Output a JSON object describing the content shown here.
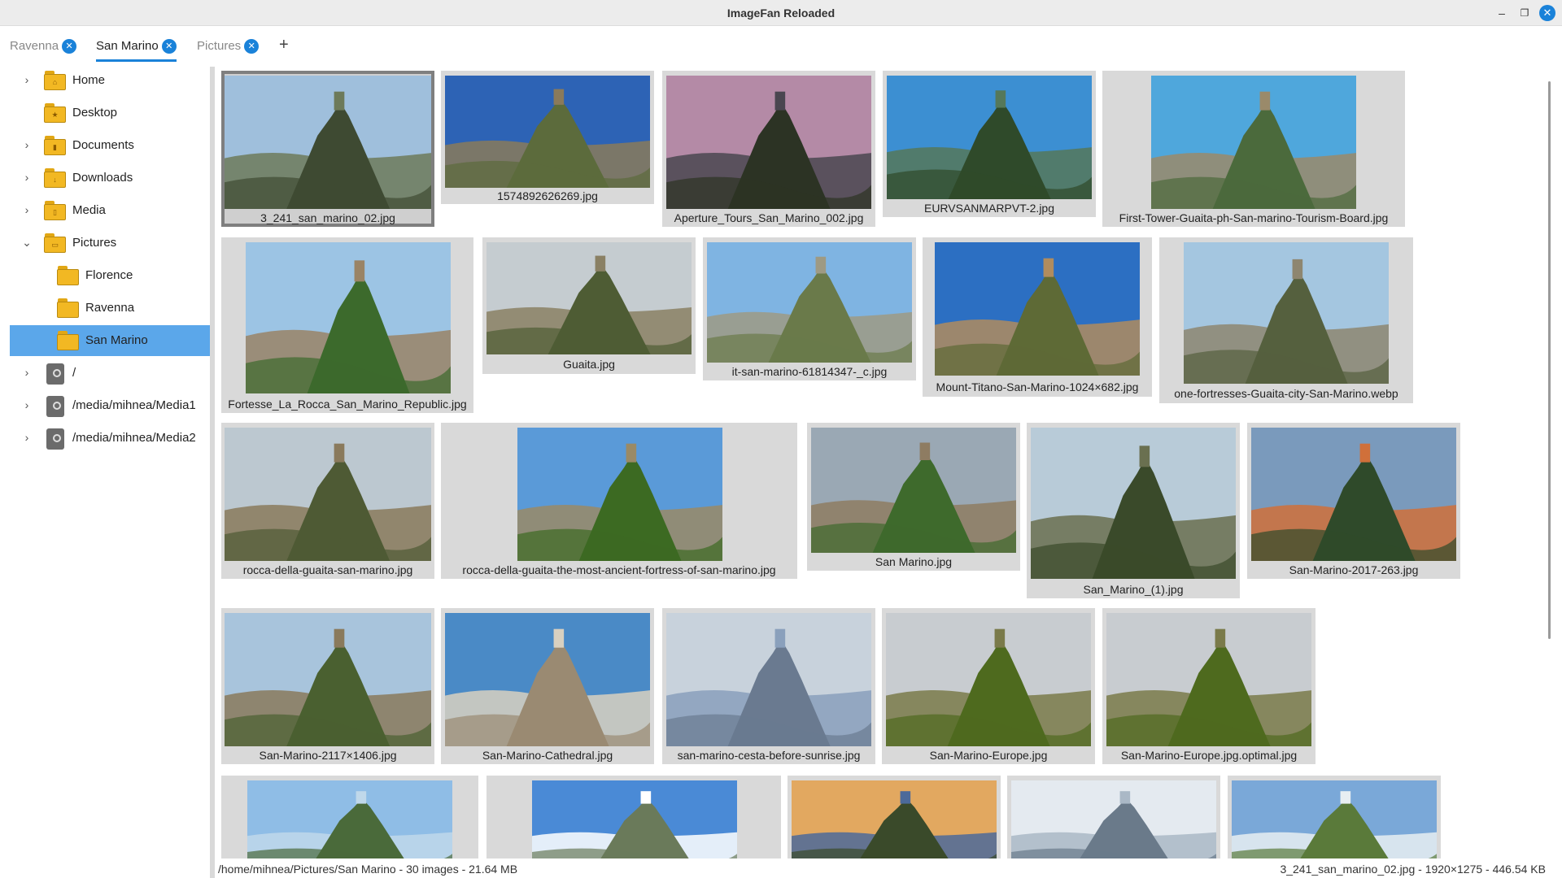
{
  "window": {
    "title": "ImageFan Reloaded"
  },
  "tabs": [
    {
      "label": "Ravenna",
      "active": false
    },
    {
      "label": "San Marino",
      "active": true
    },
    {
      "label": "Pictures",
      "active": false
    }
  ],
  "tab_add_label": "+",
  "sidebar": {
    "items": [
      {
        "label": "Home",
        "icon": "home-folder-icon",
        "badge": "⌂",
        "expandable": true
      },
      {
        "label": "Desktop",
        "icon": "desktop-folder-icon",
        "badge": "★",
        "expandable": false
      },
      {
        "label": "Documents",
        "icon": "documents-folder-icon",
        "badge": "▮",
        "expandable": true
      },
      {
        "label": "Downloads",
        "icon": "downloads-folder-icon",
        "badge": "↓",
        "expandable": true
      },
      {
        "label": "Media",
        "icon": "media-folder-icon",
        "badge": "▯",
        "expandable": true
      },
      {
        "label": "Pictures",
        "icon": "pictures-folder-icon",
        "badge": "▭",
        "expandable": true,
        "expanded": true
      },
      {
        "label": "Florence",
        "icon": "folder-icon",
        "expandable": false
      },
      {
        "label": "Ravenna",
        "icon": "folder-icon",
        "expandable": false
      },
      {
        "label": "San Marino",
        "icon": "folder-icon",
        "expandable": false,
        "selected": true
      },
      {
        "label": "/",
        "icon": "disk-icon",
        "expandable": true
      },
      {
        "label": "/media/mihnea/Media1",
        "icon": "disk-icon",
        "expandable": true
      },
      {
        "label": "/media/mihnea/Media2",
        "icon": "disk-icon",
        "expandable": true
      }
    ]
  },
  "gallery": {
    "thumbnails": [
      {
        "name": "3_241_san_marino_02.jpg",
        "selected": true,
        "palette": [
          "#9fbfdc",
          "#6d7a5a",
          "#3e4a32"
        ]
      },
      {
        "name": "1574892626269.jpg",
        "palette": [
          "#2d63b5",
          "#8a7a5b",
          "#5c6b3c"
        ]
      },
      {
        "name": "Aperture_Tours_San_Marino_002.jpg",
        "palette": [
          "#b48aa6",
          "#4a4650",
          "#2c3324"
        ]
      },
      {
        "name": "EURVSANMARPVT-2.jpg",
        "palette": [
          "#3c8fd2",
          "#55785a",
          "#2f4a2a"
        ]
      },
      {
        "name": "First-Tower-Guaita-ph-San-marino-Tourism-Board.jpg",
        "palette": [
          "#4fa7dc",
          "#9a8a6a",
          "#4b6a3c"
        ]
      },
      {
        "name": "Fortesse_La_Rocca_San_Marino_Republic.jpg",
        "palette": [
          "#9cc4e4",
          "#9a8466",
          "#3c6a2c"
        ]
      },
      {
        "name": "Guaita.jpg",
        "palette": [
          "#c5ccd0",
          "#8a8064",
          "#4e5c34"
        ]
      },
      {
        "name": "it-san-marino-61814347-_c.jpg",
        "palette": [
          "#7fb4e2",
          "#9e9a84",
          "#6a7a4a"
        ]
      },
      {
        "name": "Mount-Titano-San-Marino-1024×682.jpg",
        "palette": [
          "#2c6fc2",
          "#b08c5e",
          "#5e6a36"
        ]
      },
      {
        "name": "one-fortresses-Guaita-city-San-Marino.webp",
        "palette": [
          "#a4c6e0",
          "#8e8670",
          "#55603e"
        ]
      },
      {
        "name": "rocca-della-guaita-san-marino.jpg",
        "palette": [
          "#bcc8d0",
          "#8a7a5c",
          "#4e5a34"
        ]
      },
      {
        "name": "rocca-della-guaita-the-most-ancient-fortress-of-san-marino.jpg",
        "palette": [
          "#5a9ad8",
          "#9a8a66",
          "#3c6a22"
        ]
      },
      {
        "name": "San Marino.jpg",
        "palette": [
          "#9aa8b4",
          "#8e7c62",
          "#3e6a2c"
        ]
      },
      {
        "name": "San_Marino_(1).jpg",
        "palette": [
          "#b8cbd8",
          "#6a7050",
          "#3a4a2a"
        ]
      },
      {
        "name": "San-Marino-2017-263.jpg",
        "palette": [
          "#7a9abc",
          "#d0703a",
          "#2f4a2a"
        ]
      },
      {
        "name": "San-Marino-2117×1406.jpg",
        "palette": [
          "#a8c4dc",
          "#8a7a5c",
          "#4a6030"
        ]
      },
      {
        "name": "San-Marino-Cathedral.jpg",
        "palette": [
          "#4a8ac6",
          "#d8d0c0",
          "#9a8a72"
        ]
      },
      {
        "name": "san-marino-cesta-before-sunrise.jpg",
        "palette": [
          "#c8d2dc",
          "#8aa0bc",
          "#6a7a90"
        ]
      },
      {
        "name": "San-Marino-Europe.jpg",
        "palette": [
          "#c8ccd0",
          "#7a7a4a",
          "#4e6a1e"
        ]
      },
      {
        "name": "San-Marino-Europe.jpg.optimal.jpg",
        "palette": [
          "#c8ccd0",
          "#7a7a4a",
          "#4e6a1e"
        ]
      },
      {
        "name": "",
        "palette": [
          "#8fbde6",
          "#c0d8ea",
          "#4a6a3a"
        ]
      },
      {
        "name": "",
        "palette": [
          "#4a8ad6",
          "#ffffff",
          "#6a7a5a"
        ]
      },
      {
        "name": "",
        "palette": [
          "#e2a860",
          "#4c6a9a",
          "#3a4a2a"
        ]
      },
      {
        "name": "",
        "palette": [
          "#e4eaf0",
          "#aab8c6",
          "#6a7a8a"
        ]
      },
      {
        "name": "",
        "palette": [
          "#7aa8d8",
          "#e8eef2",
          "#5a7a3a"
        ]
      }
    ]
  },
  "status": {
    "left": "/home/mihnea/Pictures/San Marino - 30 images - 21.64 MB",
    "right": "3_241_san_marino_02.jpg - 1920×1275 - 446.54 KB"
  }
}
